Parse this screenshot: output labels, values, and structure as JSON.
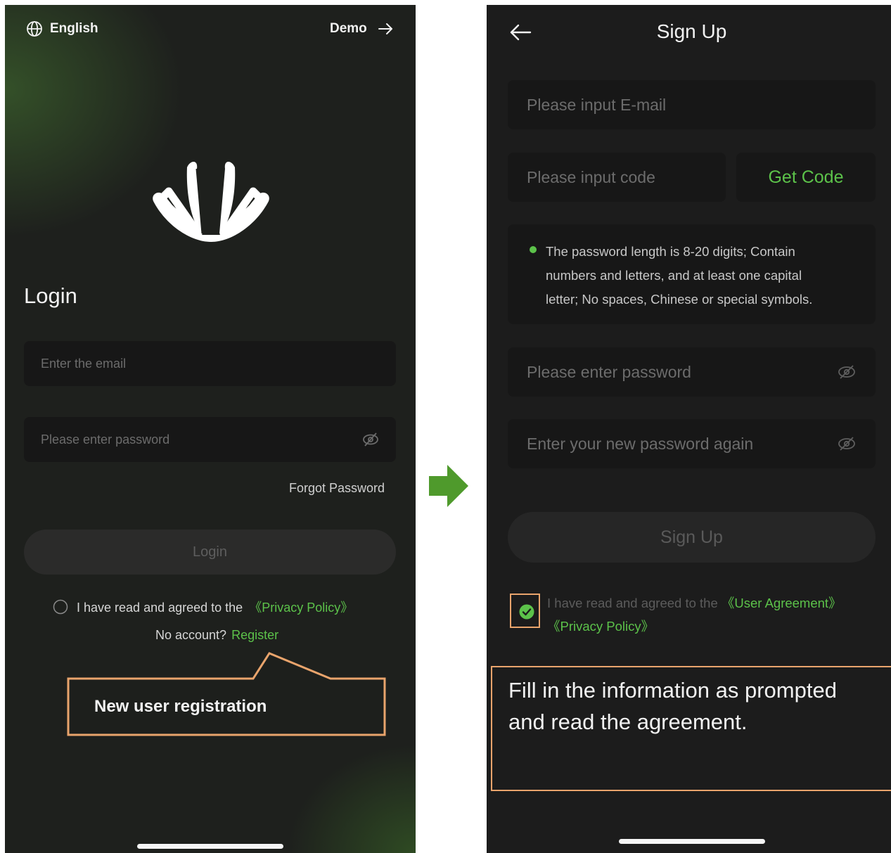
{
  "login_screen": {
    "language_label": "English",
    "demo_label": "Demo",
    "title": "Login",
    "email_placeholder": "Enter the email",
    "password_placeholder": "Please enter password",
    "forgot_password": "Forgot Password",
    "login_button": "Login",
    "agreement_text": "I have read and agreed to the",
    "privacy_policy_link": "《Privacy Policy》",
    "no_account_text": "No account?",
    "register_link": "Register"
  },
  "annotations": {
    "register_callout": "New user registration",
    "signup_note_line1": "Fill in the information as prompted",
    "signup_note_line2": "and read the agreement."
  },
  "signup_screen": {
    "title": "Sign Up",
    "email_placeholder": "Please input E-mail",
    "code_placeholder": "Please input code",
    "get_code_button": "Get Code",
    "password_rule_line1": "The password length is 8-20 digits; Contain",
    "password_rule_line2": "numbers and letters, and at least one capital",
    "password_rule_line3": "letter; No spaces, Chinese or special symbols.",
    "password_placeholder": "Please enter password",
    "confirm_password_placeholder": "Enter your new password again",
    "sign_up_button": "Sign Up",
    "agreement_text": "I have read and agreed to the",
    "user_agreement_link": "《User Agreement》",
    "privacy_policy_link": "《Privacy Policy》"
  },
  "colors": {
    "accent_green": "#5cc24a",
    "annotation_orange": "#e9a46c",
    "arrow_green": "#4f9a2c",
    "screen_bg": "#1c1c1c"
  },
  "icons": [
    "globe-icon",
    "arrow-right-icon",
    "shell-logo-icon",
    "eye-off-icon",
    "back-arrow-icon",
    "checkbox-unchecked-icon",
    "checkbox-checked-icon",
    "flow-arrow-icon"
  ]
}
